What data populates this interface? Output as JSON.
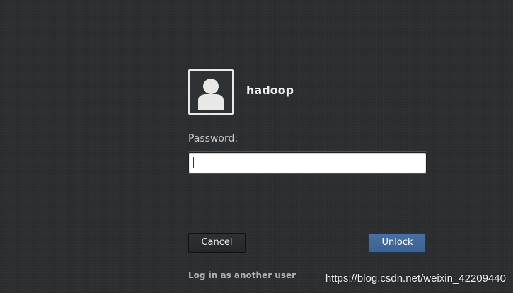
{
  "user": {
    "avatar_icon": "user-silhouette-icon",
    "name": "hadoop"
  },
  "password": {
    "label": "Password:",
    "value": ""
  },
  "buttons": {
    "cancel_label": "Cancel",
    "unlock_label": "Unlock"
  },
  "links": {
    "another_user_label": "Log in as another user"
  },
  "watermark": {
    "text": "https://blog.csdn.net/weixin_42209440"
  },
  "colors": {
    "background": "#2b2e30",
    "accent": "#3d6293",
    "text": "#eeeeec"
  }
}
